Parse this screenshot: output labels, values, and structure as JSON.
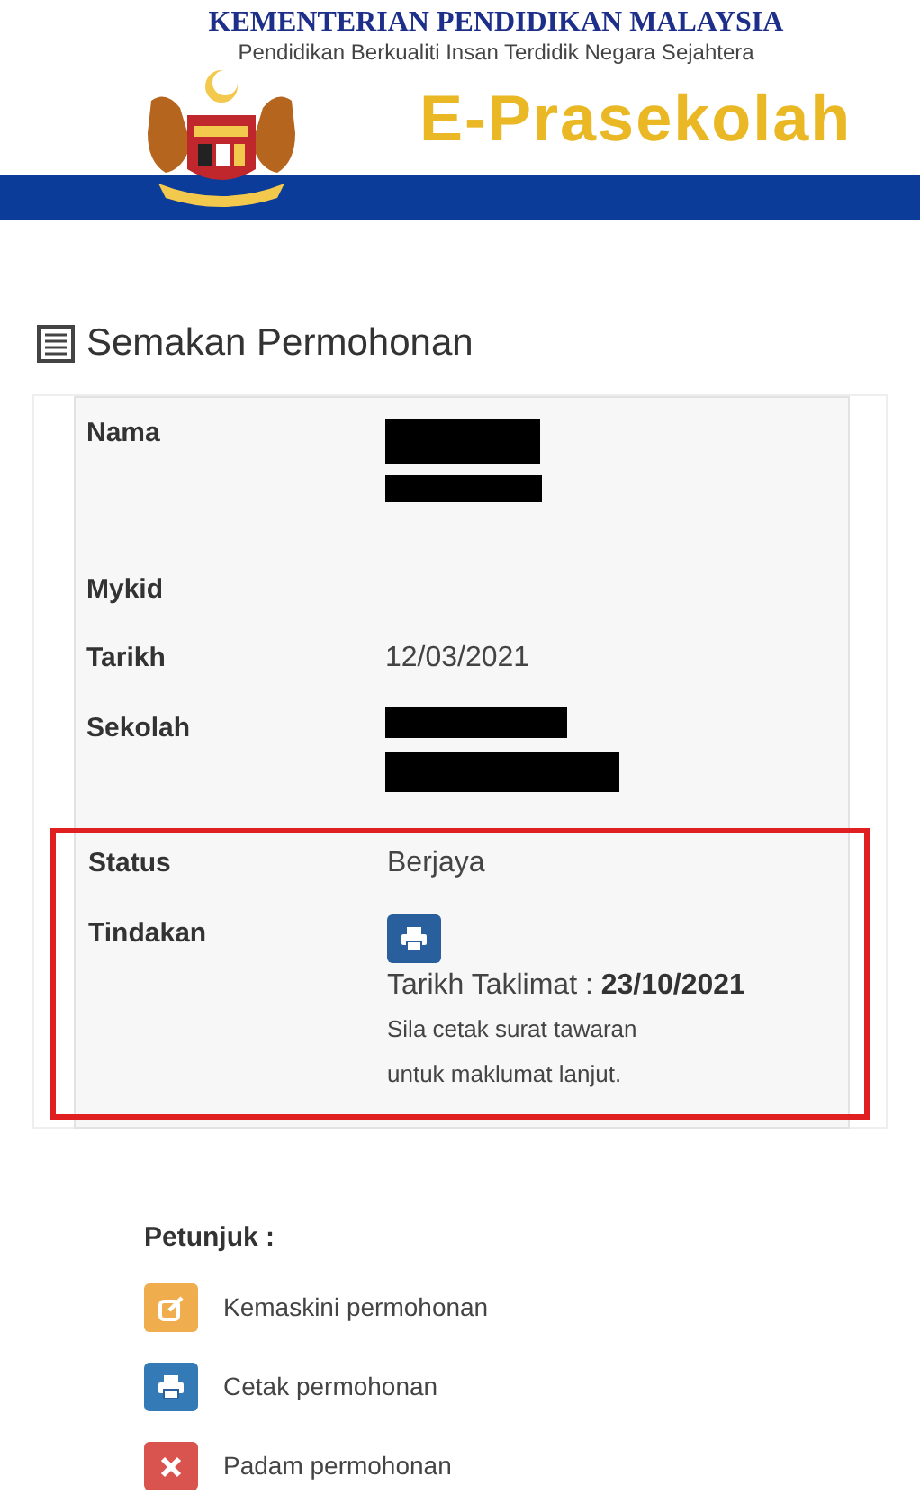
{
  "header": {
    "ministry": "KEMENTERIAN PENDIDIKAN MALAYSIA",
    "tagline": "Pendidikan Berkualiti Insan Terdidik Negara Sejahtera",
    "app_name": "E-Prasekolah"
  },
  "page_title": "Semakan Permohonan",
  "details": {
    "rows": [
      {
        "label": "Nama",
        "kind": "redacted"
      },
      {
        "label": "Mykid",
        "kind": "blank"
      },
      {
        "label": "Tarikh",
        "kind": "text",
        "value": "12/03/2021"
      },
      {
        "label": "Sekolah",
        "kind": "redacted"
      }
    ],
    "highlighted_rows": [
      {
        "label": "Status",
        "kind": "text",
        "value": "Berjaya"
      },
      {
        "label": "Tindakan",
        "kind": "action",
        "briefing_label": "Tarikh Taklimat : ",
        "briefing_date": "23/10/2021",
        "note": [
          "Sila cetak surat tawaran",
          "untuk maklumat lanjut."
        ]
      }
    ]
  },
  "legend": {
    "title": "Petunjuk :",
    "items": [
      {
        "kind": "edit",
        "color": "#f0ad4e",
        "label": "Kemaskini permohonan"
      },
      {
        "kind": "print",
        "color": "#337ab7",
        "label": "Cetak permohonan"
      },
      {
        "kind": "delete",
        "color": "#d9534f",
        "label": "Padam permohonan"
      }
    ]
  }
}
